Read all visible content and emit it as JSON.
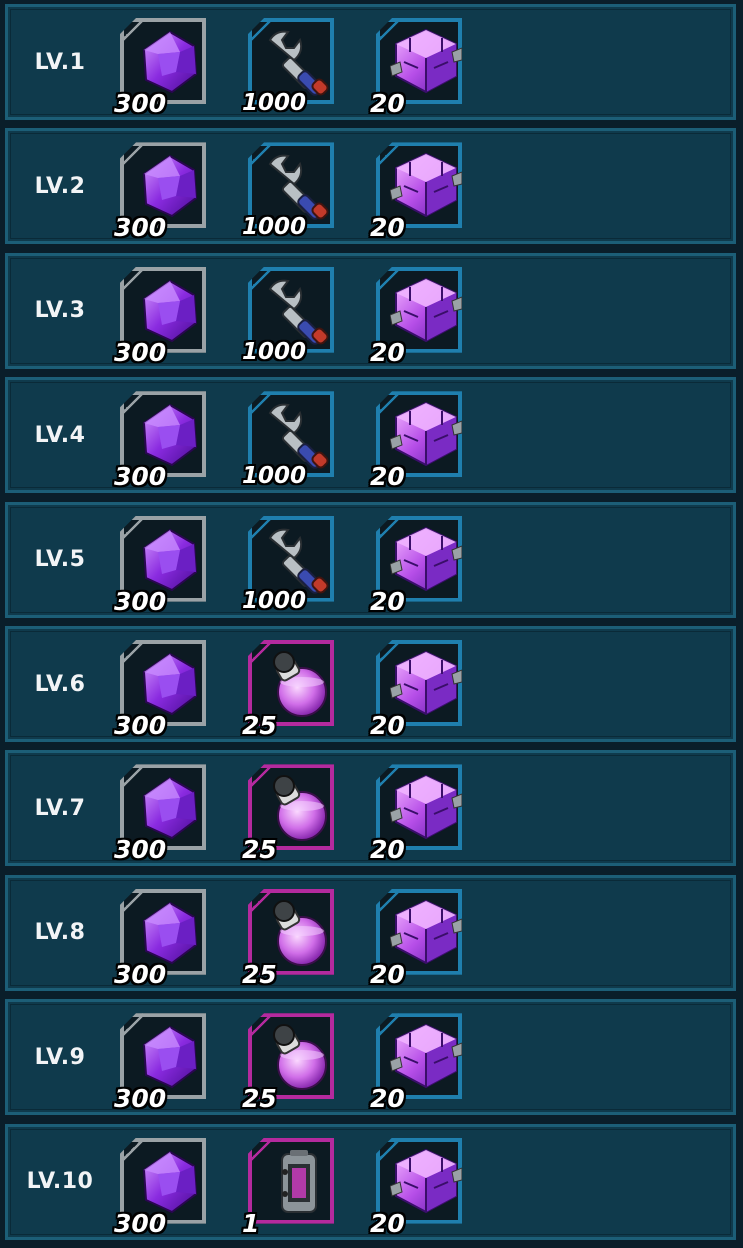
{
  "rows": [
    {
      "level": "LV.1",
      "items": [
        {
          "name": "gem",
          "qty": "300"
        },
        {
          "name": "wrench",
          "qty": "1000"
        },
        {
          "name": "cube",
          "qty": "20"
        }
      ]
    },
    {
      "level": "LV.2",
      "items": [
        {
          "name": "gem",
          "qty": "300"
        },
        {
          "name": "wrench",
          "qty": "1000"
        },
        {
          "name": "cube",
          "qty": "20"
        }
      ]
    },
    {
      "level": "LV.3",
      "items": [
        {
          "name": "gem",
          "qty": "300"
        },
        {
          "name": "wrench",
          "qty": "1000"
        },
        {
          "name": "cube",
          "qty": "20"
        }
      ]
    },
    {
      "level": "LV.4",
      "items": [
        {
          "name": "gem",
          "qty": "300"
        },
        {
          "name": "wrench",
          "qty": "1000"
        },
        {
          "name": "cube",
          "qty": "20"
        }
      ]
    },
    {
      "level": "LV.5",
      "items": [
        {
          "name": "gem",
          "qty": "300"
        },
        {
          "name": "wrench",
          "qty": "1000"
        },
        {
          "name": "cube",
          "qty": "20"
        }
      ]
    },
    {
      "level": "LV.6",
      "items": [
        {
          "name": "gem",
          "qty": "300"
        },
        {
          "name": "potion",
          "qty": "25"
        },
        {
          "name": "cube",
          "qty": "20"
        }
      ]
    },
    {
      "level": "LV.7",
      "items": [
        {
          "name": "gem",
          "qty": "300"
        },
        {
          "name": "potion",
          "qty": "25"
        },
        {
          "name": "cube",
          "qty": "20"
        }
      ]
    },
    {
      "level": "LV.8",
      "items": [
        {
          "name": "gem",
          "qty": "300"
        },
        {
          "name": "potion",
          "qty": "25"
        },
        {
          "name": "cube",
          "qty": "20"
        }
      ]
    },
    {
      "level": "LV.9",
      "items": [
        {
          "name": "gem",
          "qty": "300"
        },
        {
          "name": "potion",
          "qty": "25"
        },
        {
          "name": "cube",
          "qty": "20"
        }
      ]
    },
    {
      "level": "LV.10",
      "items": [
        {
          "name": "gem",
          "qty": "300"
        },
        {
          "name": "device",
          "qty": "1"
        },
        {
          "name": "cube",
          "qty": "20"
        }
      ]
    }
  ],
  "icons": {
    "gem": "purple-gem-icon",
    "wrench": "wrench-icon",
    "potion": "purple-potion-icon",
    "device": "chip-device-icon",
    "cube": "purple-cube-icon"
  },
  "colors": {
    "row_bg": "#0f3a4c",
    "row_border": "#1c5e77",
    "frame_grey": "#9aa2a6",
    "frame_blue": "#1f7fae",
    "frame_purple": "#b42a9e"
  }
}
